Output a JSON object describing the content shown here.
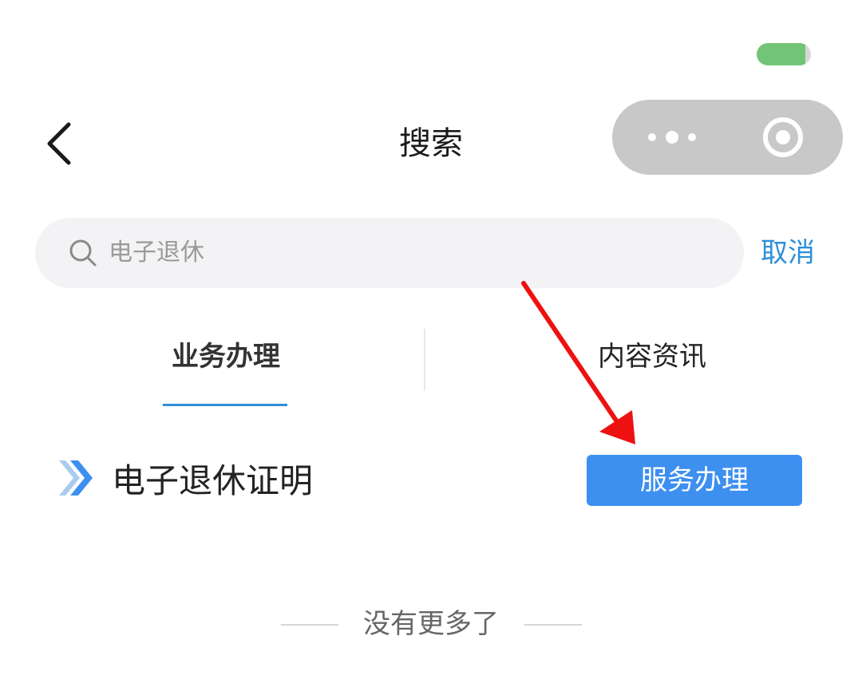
{
  "status": {
    "battery_level": 0.9,
    "battery_color": "#72c477"
  },
  "header": {
    "title": "搜索",
    "back_icon": "chevron-left-icon",
    "capsule": {
      "more_icon": "more-dots-icon",
      "close_icon": "close-target-icon"
    }
  },
  "search": {
    "value": "电子退休",
    "cancel_label": "取消"
  },
  "tabs": [
    {
      "label": "业务办理",
      "active": true
    },
    {
      "label": "内容资讯",
      "active": false
    }
  ],
  "results": [
    {
      "title": "电子退休证明",
      "action_label": "服务办理"
    }
  ],
  "footer": {
    "end_text": "没有更多了"
  },
  "colors": {
    "accent": "#2f8fd8",
    "button": "#3d8ff0",
    "annotation_arrow": "#ee1111"
  }
}
